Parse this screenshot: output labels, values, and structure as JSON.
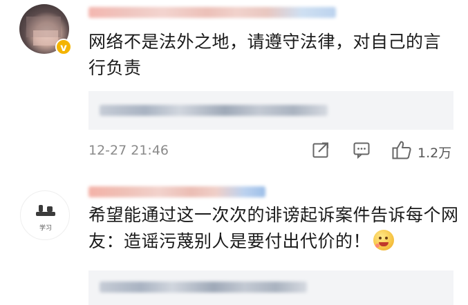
{
  "comments": [
    {
      "text": "网络不是法外之地，请遵守法律，对自己的言行负责",
      "timestamp": "12-27 21:46",
      "like_count": "1.2万",
      "verified_badge": "v"
    },
    {
      "text": "希望能通过这一次次的诽谤起诉案件告诉每个网友：造谣污蔑别人是要付出代价的！",
      "avatar_caption": "学习"
    }
  ],
  "icons": {
    "share": "share-icon",
    "comment": "comment-icon",
    "like": "thumbs-up-icon",
    "emoji": "drooling-face-emoji-icon"
  },
  "colors": {
    "text": "#1a1a1a",
    "meta": "#8a8a8a",
    "reply_bg": "#f3f4f6",
    "badge": "#f4b400"
  }
}
